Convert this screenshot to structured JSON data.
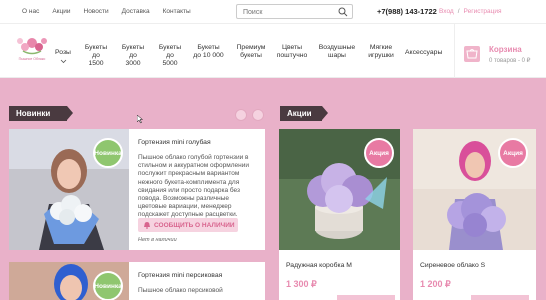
{
  "topnav": [
    "О нас",
    "Акции",
    "Новости",
    "Доставка",
    "Контакты"
  ],
  "search": {
    "placeholder": "Поиск"
  },
  "phone": "+7(988) 143-1722",
  "auth": {
    "login": "Вход",
    "separator": "/",
    "register": "Регистрация"
  },
  "logo": {
    "text": "Пышное Облако"
  },
  "menu": [
    {
      "label": "Розы",
      "has_dropdown": true
    },
    {
      "label": "Букеты до 1500"
    },
    {
      "label": "Букеты до 3000"
    },
    {
      "label": "Букеты до 5000"
    },
    {
      "label": "Букеты до 10 000"
    },
    {
      "label": "Премиум букеты"
    },
    {
      "label": "Цветы поштучно"
    },
    {
      "label": "Воздушные шары"
    },
    {
      "label": "Мягкие игрушки"
    },
    {
      "label": "Аксессуары"
    }
  ],
  "cart": {
    "title": "Корзина",
    "summary": "0 товаров - 0 ₽"
  },
  "sections": {
    "new": "Новинки",
    "sale": "Акции"
  },
  "new_products": [
    {
      "badge": "Новинка",
      "title": "Гортензия mini голубая",
      "description": "Пышное облако голубой гортензии в стильном и аккуратном оформлении послужит прекрасным вариантом нежного букета-комплимента для свидания или просто подарка без повода. Возможны различные цветовые вариации, менеджер подскажет доступные расцветки.",
      "button": "СООБЩИТЬ О НАЛИЧИИ",
      "stock": "Нет в наличии"
    },
    {
      "badge": "Новинка",
      "title": "Гортензия mini персиковая",
      "description": "Пышное облако персиковой"
    }
  ],
  "sale_products": [
    {
      "badge": "Акция",
      "title": "Радужная коробка М",
      "price": "1 300 ₽"
    },
    {
      "badge": "Акция",
      "title": "Сиреневое облако S",
      "price": "1 200 ₽"
    }
  ],
  "colors": {
    "accent": "#e88bb0",
    "background": "#e9b1c9",
    "new_badge": "#8fc66f",
    "sale_badge": "#e87aa3",
    "section_header": "#4a3a40"
  }
}
